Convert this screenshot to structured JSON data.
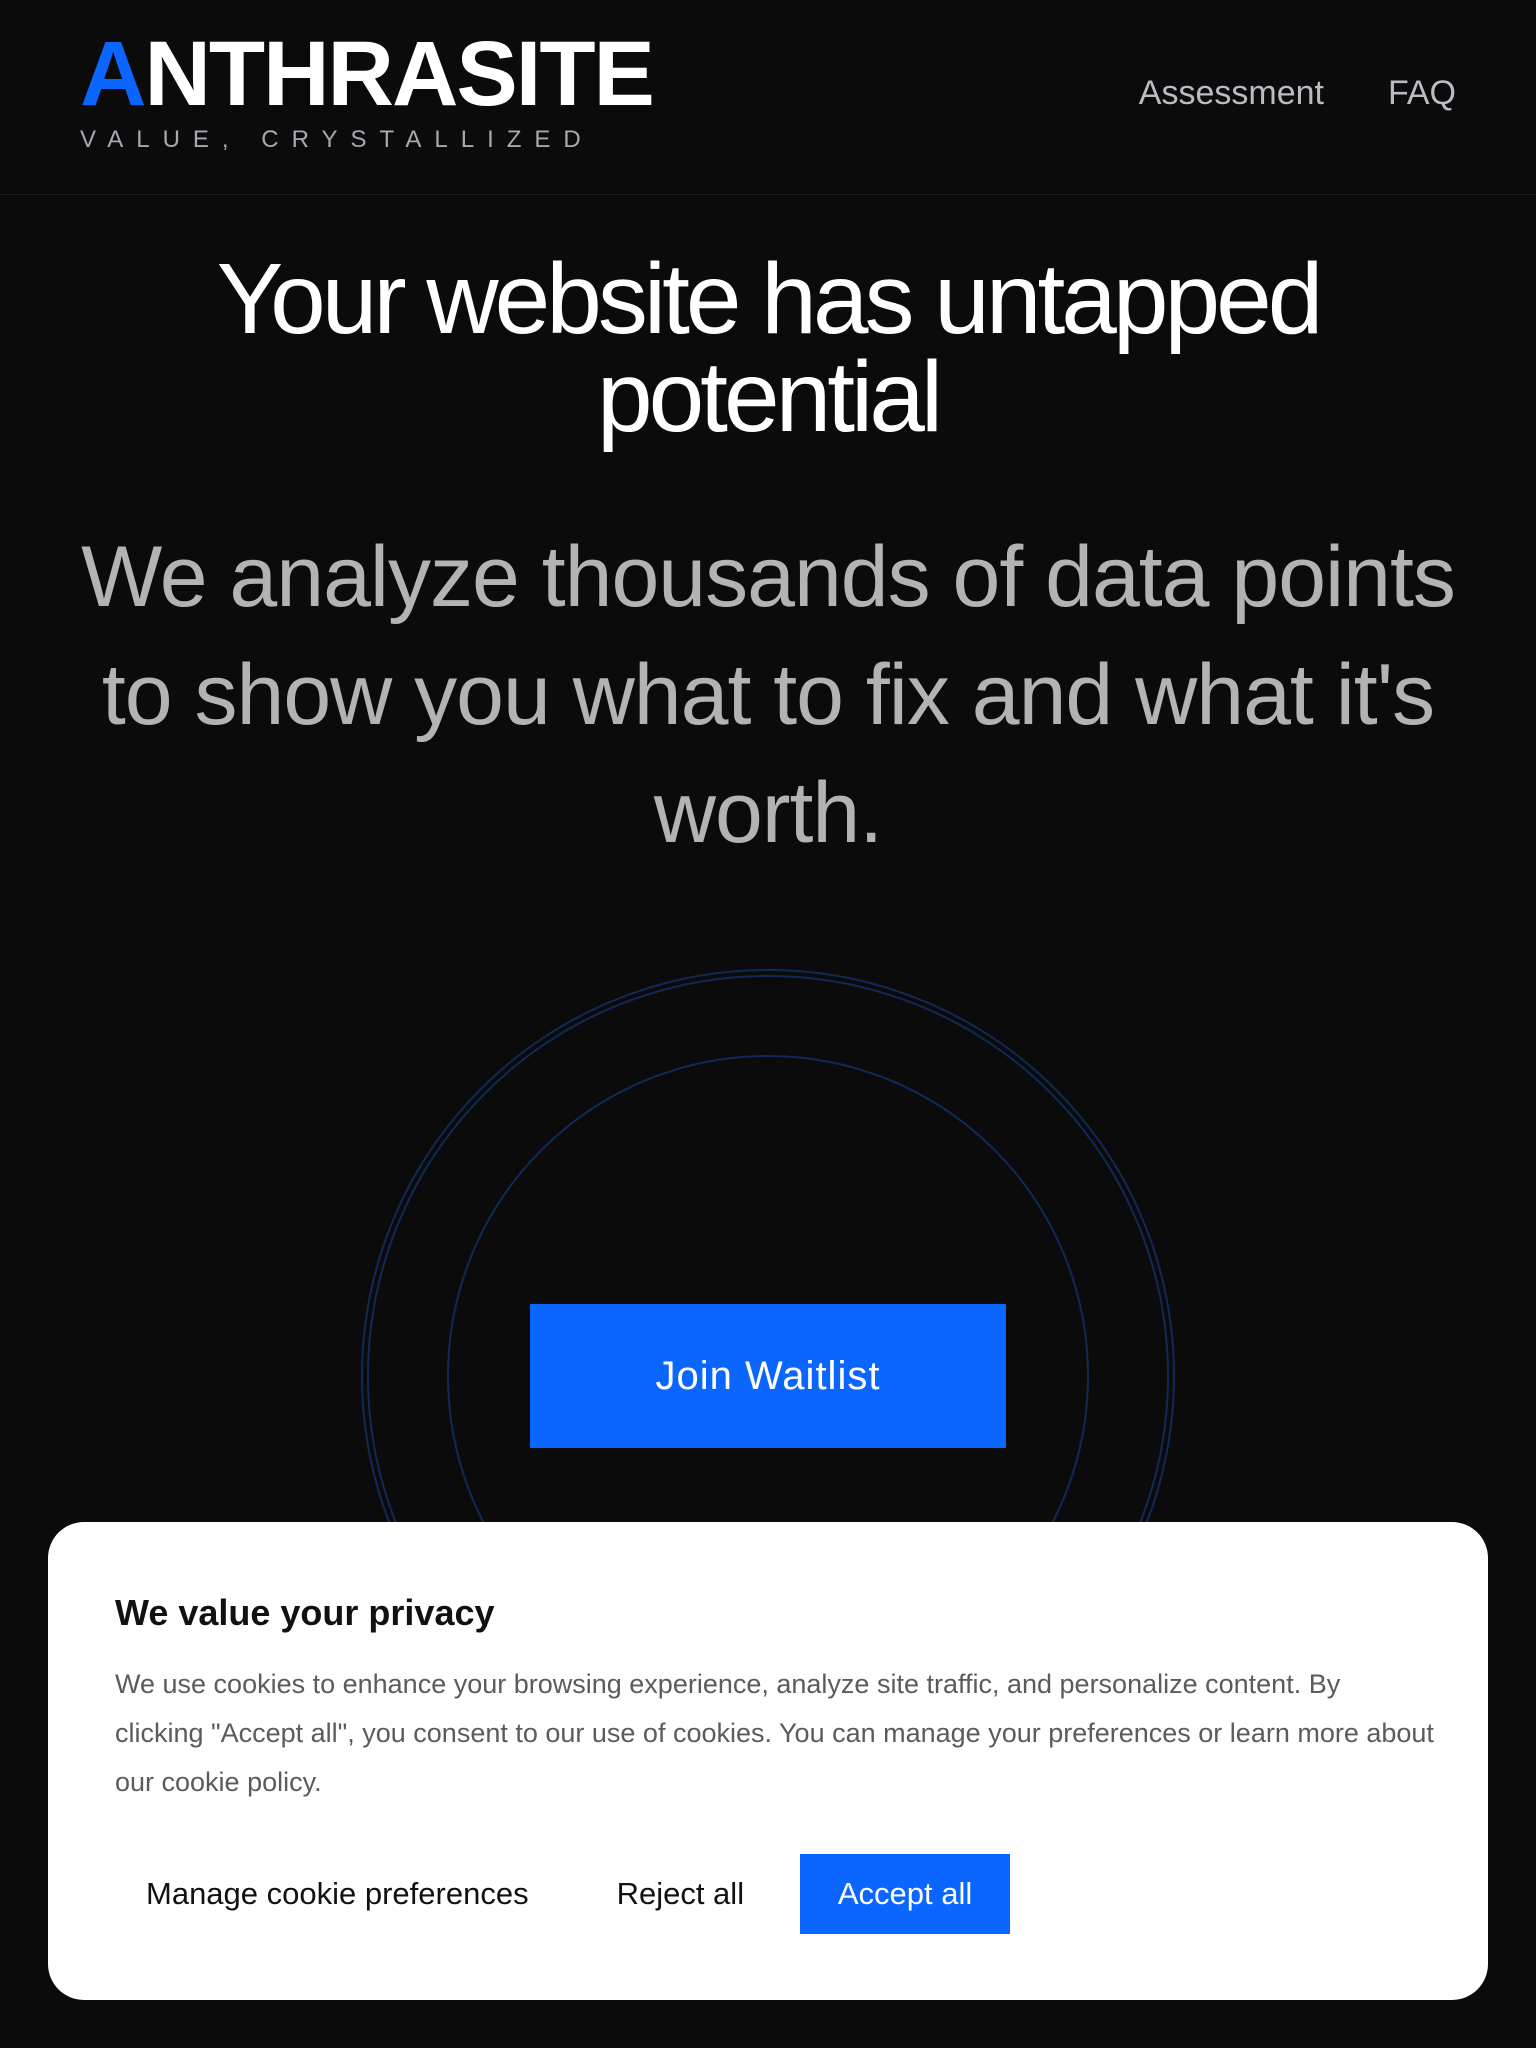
{
  "brand": {
    "name_accent": "A",
    "name_rest": "NTHRASITE",
    "tagline": "VALUE, CRYSTALLIZED",
    "accent_color": "#0a66ff"
  },
  "nav": {
    "items": [
      {
        "label": "Assessment"
      },
      {
        "label": "FAQ"
      }
    ]
  },
  "hero": {
    "title": "Your website has untapped potential",
    "subtitle": "We analyze thousands of data points to show you what to fix and what it's worth.",
    "cta_label": "Join Waitlist"
  },
  "cookie_banner": {
    "title": "We value your privacy",
    "body": "We use cookies to enhance your browsing experience, analyze site traffic, and personalize content. By clicking \"Accept all\", you consent to our use of cookies. You can manage your preferences or learn more about our cookie policy.",
    "manage_label": "Manage cookie preferences",
    "reject_label": "Reject all",
    "accept_label": "Accept all"
  },
  "colors": {
    "background": "#0b0b0c",
    "primary": "#0a66ff",
    "ring": "#0f2a57"
  }
}
